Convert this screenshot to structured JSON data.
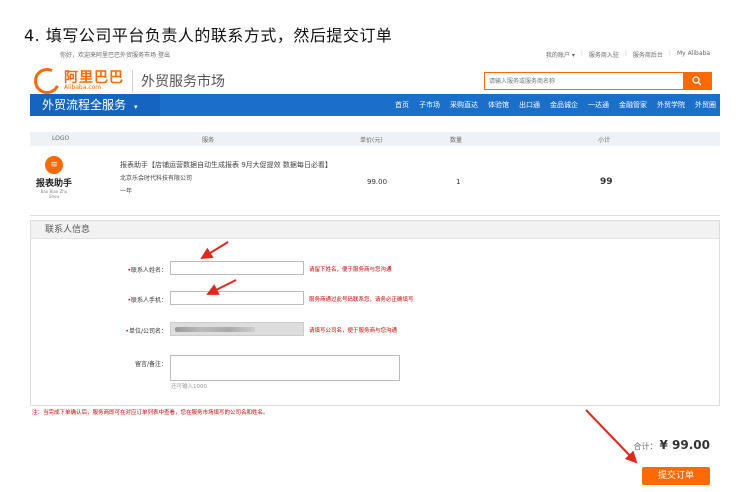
{
  "heading": "4. 填写公司平台负责人的联系方式，然后提交订单",
  "topbar": {
    "greeting": "你好，欢迎来阿里巴巴外贸服务市场",
    "logout": "登出",
    "links": [
      "我的账户 ▾",
      "服务商入驻",
      "服务商后台",
      "My Alibaba"
    ]
  },
  "brand": {
    "logo_cn": "阿里巴巴",
    "logo_en": "Alibaba.com",
    "site_name": "外贸服务市场"
  },
  "search": {
    "placeholder": "请输入服务或服务商名称",
    "icon": "search-icon"
  },
  "nav": {
    "title": "外贸流程全服务",
    "items": [
      "首页",
      "子市场",
      "采购直达",
      "体验馆",
      "出口通",
      "金品诚企",
      "一达通",
      "金融管家",
      "外贸学院",
      "外贸圈"
    ]
  },
  "table": {
    "headers": [
      "LOGO",
      "服务",
      "单价(元)",
      "数量",
      "小计"
    ],
    "product": {
      "logo_name": "报表助手",
      "logo_pinyin": "Bao Biao Zhu Shou",
      "title": "报表助手【店铺运营数据自动生成报表 9月大促提效 数据每日必看】",
      "company": "北京乐会时代科技有限公司",
      "period": "一年",
      "price": "99.00",
      "quantity": "1",
      "subtotal": "99"
    }
  },
  "contact": {
    "title": "联系人信息",
    "name_label": "联系人姓名：",
    "name_hint": "请留下姓名，便于服务商与您沟通",
    "phone_label": "联系人手机：",
    "phone_hint": "服务商通过此号码联系您，请务必正确填写",
    "company_label": "单位/公司名：",
    "company_hint": "请填写公司名，便于服务商与您沟通",
    "remark_label": "留言/备注：",
    "remark_hint": "还可输入1000"
  },
  "note": "注：当完成下单确认后，服务商即可在对应订单列表中查看，您在服务市场填写的公司名和姓名。",
  "total": {
    "label": "合计：",
    "currency": "¥",
    "amount": "99.00"
  },
  "submit_label": "提交订单",
  "colors": {
    "brand_orange": "#ff6a00",
    "nav_blue": "#1a6fc9",
    "hint_red": "#c00000",
    "arrow_red": "#e0281e"
  }
}
